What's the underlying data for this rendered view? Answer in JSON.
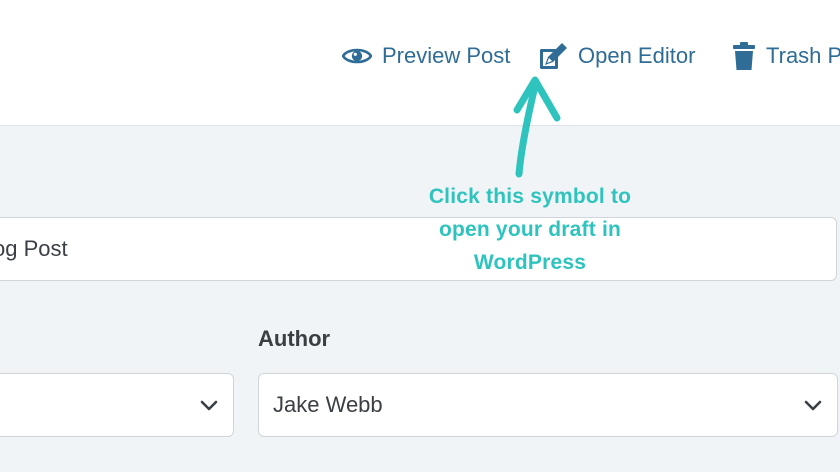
{
  "toolbar": {
    "preview_label": "Preview Post",
    "editor_label": "Open Editor",
    "trash_label": "Trash Post",
    "accent_color": "#2f6d96",
    "icons": [
      "eye-icon",
      "edit-icon",
      "trash-icon"
    ]
  },
  "form": {
    "title_value": "og Post",
    "author_label": "Author",
    "author_value": "Jake Webb",
    "left_select_value": ""
  },
  "annotation": {
    "text_line1": "Click this symbol to",
    "text_line2": "open your draft in",
    "text_line3": "WordPress",
    "color": "#2ec4bd"
  }
}
